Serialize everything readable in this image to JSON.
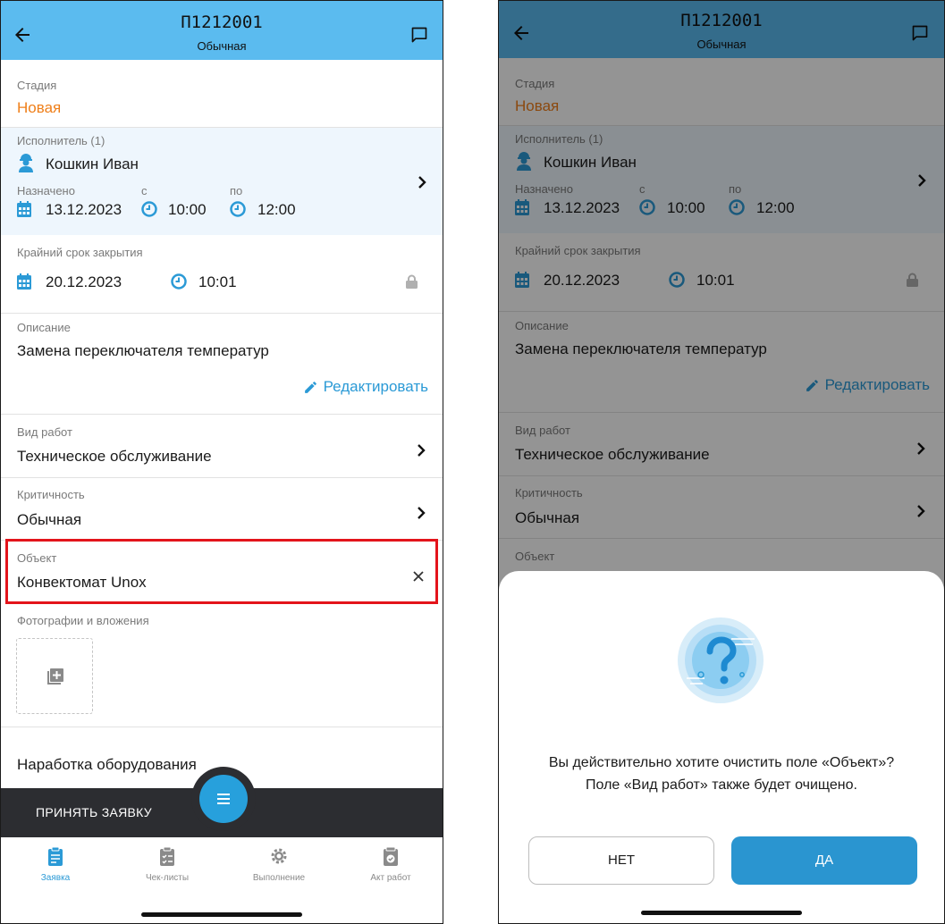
{
  "header": {
    "title": "П1212001",
    "subtitle": "Обычная"
  },
  "stage": {
    "label": "Стадия",
    "value": "Новая"
  },
  "executor": {
    "label": "Исполнитель (1)",
    "name": "Кошкин Иван",
    "assigned_label": "Назначено",
    "assigned_date": "13.12.2023",
    "from_label": "с",
    "from_time": "10:00",
    "to_label": "по",
    "to_time": "12:00"
  },
  "deadline": {
    "label": "Крайний срок закрытия",
    "date": "20.12.2023",
    "time": "10:01"
  },
  "description": {
    "label": "Описание",
    "text": "Замена переключателя температур",
    "edit_label": "Редактировать"
  },
  "work_type": {
    "label": "Вид работ",
    "value": "Техническое обслуживание"
  },
  "criticality": {
    "label": "Критичность",
    "value": "Обычная"
  },
  "object": {
    "label": "Объект",
    "value": "Конвектомат Unox"
  },
  "attachments": {
    "label": "Фотографии и вложения"
  },
  "operating_hours": {
    "label": "Наработка оборудования"
  },
  "bottom_bar": {
    "accept_label": "ПРИНЯТЬ ЗАЯВКУ"
  },
  "tabs": [
    {
      "label": "Заявка",
      "icon": "clipboard-icon",
      "active": true
    },
    {
      "label": "Чек-листы",
      "icon": "checklist-icon",
      "active": false
    },
    {
      "label": "Выполнение",
      "icon": "gear-icon",
      "active": false
    },
    {
      "label": "Акт работ",
      "icon": "act-icon",
      "active": false
    }
  ],
  "dialog": {
    "message_line1": "Вы действительно хотите очистить поле «Объект»?",
    "message_line2": "Поле «Вид работ» также будет очищено.",
    "no_label": "НЕТ",
    "yes_label": "ДА"
  },
  "colors": {
    "header": "#5bbbef",
    "accent": "#2b9ad6",
    "stage": "#ef7f1a",
    "highlight": "#e3141b"
  }
}
